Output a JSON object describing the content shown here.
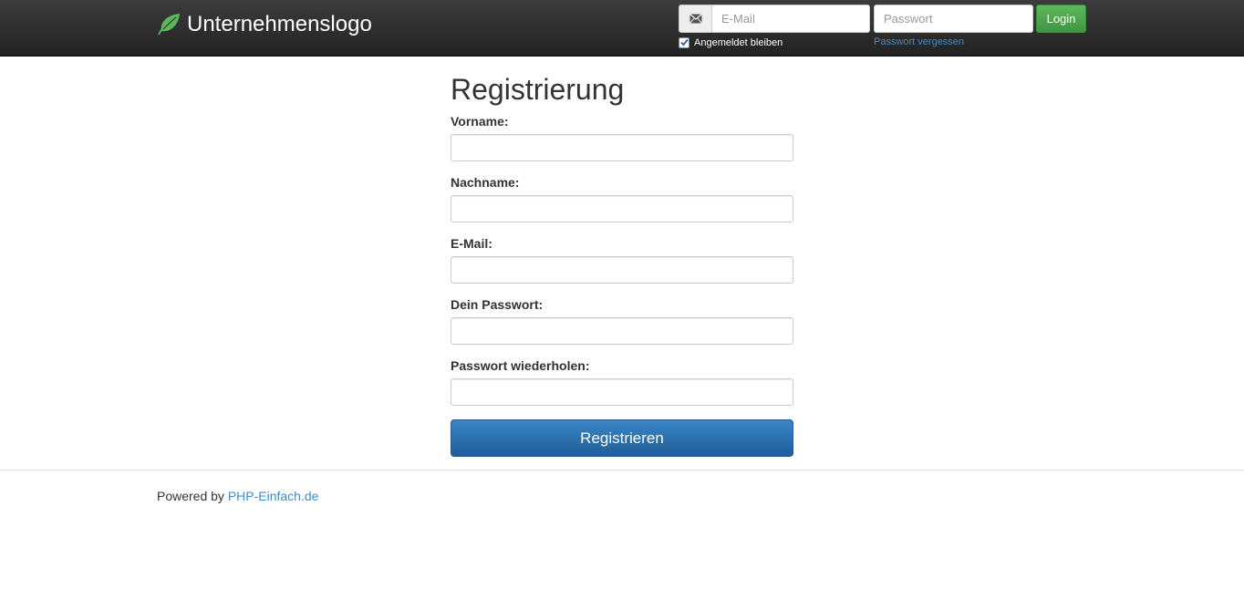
{
  "navbar": {
    "brand_icon": "leaf-icon",
    "brand_text": "Unternehmenslogo",
    "email_icon": "envelope-icon",
    "email_placeholder": "E-Mail",
    "password_placeholder": "Passwort",
    "login_label": "Login",
    "remember_label": "Angemeldet bleiben",
    "remember_checked": true,
    "forgot_label": "Passwort vergessen"
  },
  "main": {
    "title": "Registrierung",
    "fields": [
      {
        "label": "Vorname:",
        "value": ""
      },
      {
        "label": "Nachname:",
        "value": ""
      },
      {
        "label": "E-Mail:",
        "value": ""
      },
      {
        "label": "Dein Passwort:",
        "value": ""
      },
      {
        "label": "Passwort wiederholen:",
        "value": ""
      }
    ],
    "submit_label": "Registrieren"
  },
  "footer": {
    "prefix": "Powered by",
    "link_text": "PHP-Einfach.de"
  },
  "colors": {
    "navbar_bg": "#222222",
    "login_green": "#5cb85c",
    "primary_blue": "#2d6ca2",
    "link_blue": "#428bca"
  }
}
